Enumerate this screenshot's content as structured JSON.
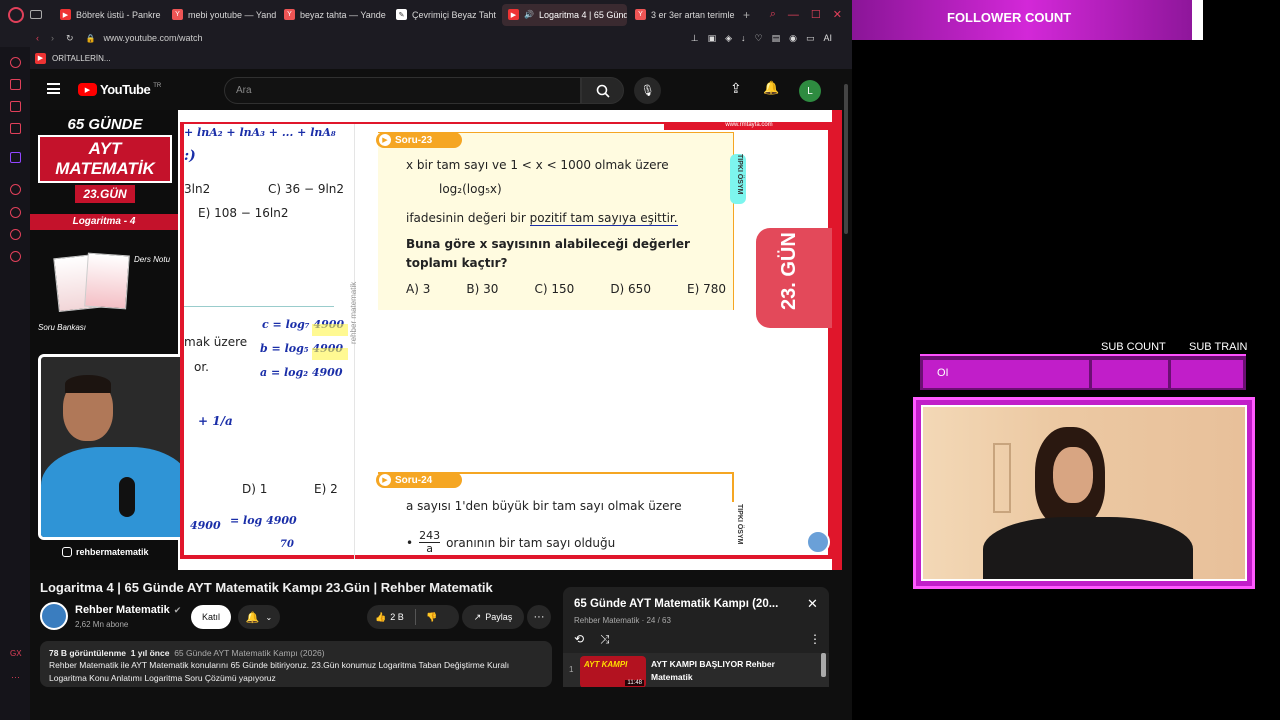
{
  "browser": {
    "tabs": [
      {
        "label": "Böbrek üstü - Pankre",
        "icon": "youtube"
      },
      {
        "label": "mebi youtube — Yand",
        "icon": "yandex"
      },
      {
        "label": "beyaz tahta — Yande",
        "icon": "yandex"
      },
      {
        "label": "Çevrimiçi Beyaz Taht",
        "icon": "whiteboard"
      },
      {
        "label": "Logaritma 4 | 65 Günd",
        "icon": "youtube",
        "active": true
      },
      {
        "label": "3 er 3er artan terimle",
        "icon": "yandex"
      }
    ],
    "url": "www.youtube.com/watch",
    "bookmark": "ORİTALLERİN..."
  },
  "youtube": {
    "logo": "YouTube",
    "region": "TR",
    "search_placeholder": "Ara",
    "avatar_letter": "L",
    "video": {
      "left": {
        "title_line1": "65 GÜNDE",
        "title_line2": "AYT MATEMATİK",
        "day": "23.GÜN",
        "topic": "Logaritma - 4",
        "notes_label": "Ders Notu",
        "bank_label": "Soru Bankası",
        "instagram": "rehbermatematik"
      },
      "book": {
        "site": "www.rmtayfa.com",
        "side_label": "rehber matematik",
        "frag_top": "+ lnA₂ + lnA₃ + ... + lnA₈",
        "frag_c": "C) 36 − 9ln2",
        "frag_b": "3ln2",
        "frag_e": "E) 108 − 16ln2",
        "frag_mid1": "mak üzere",
        "frag_mid2": "or.",
        "frag_d": "D) 1",
        "frag_e2": "E) 2",
        "q23_label": "Soru-23",
        "q23_line1": "x bir tam sayı ve 1 < x < 1000 olmak üzere",
        "q23_expr": "log₂(log₅x)",
        "q23_line3a": "ifadesinin değeri bir",
        "q23_line3b": "pozitif tam sayıya eşittir.",
        "q23_bold": "Buna göre x sayısının alabileceği değerler toplamı kaçtır?",
        "q23_opts": [
          "A) 3",
          "B) 30",
          "C) 150",
          "D) 650",
          "E) 780"
        ],
        "tipki": "TIPKI ÖSYM",
        "day_badge": "23. GÜN",
        "q24_label": "Soru-24",
        "q24_line1": "a sayısı 1'den büyük bir tam sayı olmak üzere",
        "q24_frac_num": "243",
        "q24_frac_den": "a",
        "q24_line2": "oranının bir tam sayı olduğu",
        "hand_c": "c = log₇ 4900",
        "hand_b": "b = log₅ 4900",
        "hand_a": "a = log₂ 4900",
        "hand_frac": "+ 1/a",
        "hand_bottom1": "4900",
        "hand_bottom2": "= log 4900",
        "hand_bottom3": "70"
      }
    },
    "title": "Logaritma 4 | 65 Günde AYT Matematik Kampı 23.Gün | Rehber Matematik",
    "channel": "Rehber Matematik",
    "subs": "2,62 Mn abone",
    "join": "Katıl",
    "likes": "2 B",
    "share": "Paylaş",
    "desc_views": "78 B görüntülenme",
    "desc_time": "1 yıl önce",
    "desc_tag": "65 Günde AYT Matematik Kampı (2026)",
    "desc_text": "Rehber Matematik ile AYT Matematik konularını 65 Günde bitiriyoruz. 23.Gün konumuz Logaritma Taban Değiştirme Kuralı Logaritma Konu Anlatımı Logaritma Soru Çözümü yapıyoruz",
    "playlist": {
      "title": "65 Günde AYT Matematik Kampı (20...",
      "sub": "Rehber Matematik · 24 / 63",
      "item_index": "1",
      "item_title": "AYT KAMPI BAŞLIYOR Rehber Matematik",
      "item_duration": "11:48",
      "item_thumb_text": "AYT KAMPI"
    }
  },
  "stream": {
    "follower": "FOLLOWER COUNT",
    "sub_count": "SUB COUNT",
    "sub_train": "SUB TRAIN",
    "alert_text": "OI"
  },
  "colors": {
    "accent_red": "#e0162b",
    "magenta": "#c11ec9",
    "orange": "#f5a623"
  }
}
